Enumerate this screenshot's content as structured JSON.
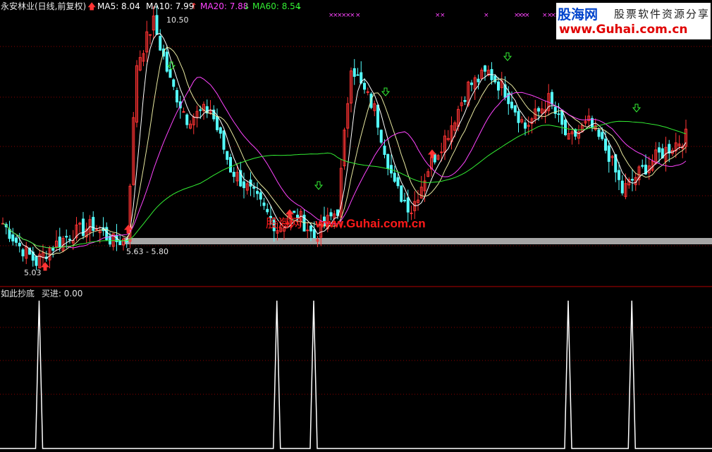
{
  "header": {
    "stock_title": "永安林业(日线,前复权)",
    "ma5_label": "MA5: 8.04",
    "ma10_label": "MA10: 7.99",
    "ma20_label": "MA20: 7.88",
    "ma60_label": "MA60: 8.54",
    "ma5_color": "#ffffff",
    "ma10_color": "#ffffff",
    "ma20_color": "#ff44ff",
    "ma60_color": "#33ee33",
    "ma5_arrow": "up",
    "ma10_arrow": "up",
    "ma20_arrow": "down",
    "ma60_arrow": "down"
  },
  "watermark": {
    "logo_text": "股海网",
    "tagline": "股票软件资源分享",
    "url": "www.Guhai.com.cn",
    "mid_logo": "股海网",
    "mid_url": "www.Guhai.com.cn"
  },
  "indicator": {
    "title": "如此抄底",
    "value_label": "买进: 0.00"
  },
  "colors": {
    "up_candle": "#ff3333",
    "down_candle": "#54ffff",
    "grid": "#8b0000",
    "band": "#a6a6a6",
    "signal": "#ffffff"
  },
  "chart_data": [
    {
      "type": "candlestick",
      "title": "永安林业(日线,前复权)",
      "series": [
        {
          "name": "MA5",
          "value": 8.04
        },
        {
          "name": "MA10",
          "value": 7.99
        },
        {
          "name": "MA20",
          "value": 7.88
        },
        {
          "name": "MA60",
          "value": 8.54
        }
      ],
      "annotations": {
        "high_label": "10.50",
        "low_label": "5.03",
        "band_label": "5.63 - 5.80"
      },
      "band_range": [
        5.63,
        5.8
      ],
      "ylim": [
        4.5,
        11.0
      ],
      "grid": true,
      "days": 205
    },
    {
      "type": "line",
      "title": "如此抄底",
      "series": [
        {
          "name": "买进",
          "current": 0.0
        }
      ],
      "signal_days": [
        10,
        81,
        92,
        168,
        187
      ],
      "ylim": [
        0,
        1
      ]
    }
  ]
}
